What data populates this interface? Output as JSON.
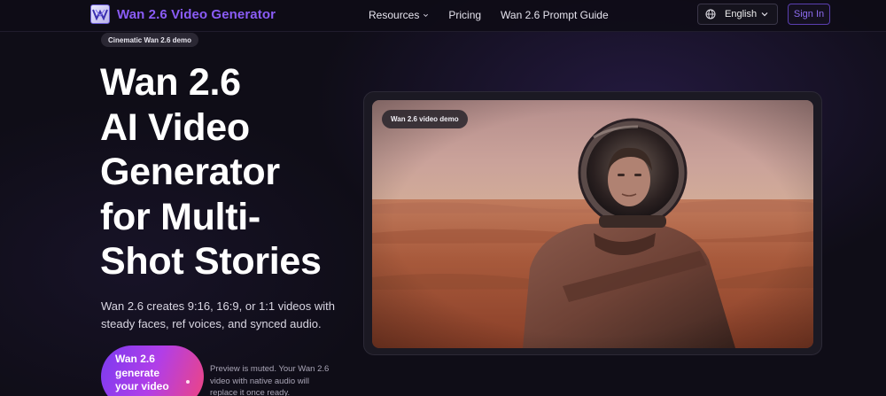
{
  "header": {
    "brand": "Wan 2.6 Video Generator",
    "nav": [
      {
        "label": "Resources"
      },
      {
        "label": "Pricing"
      },
      {
        "label": "Wan 2.6 Prompt Guide"
      }
    ],
    "language": "English",
    "sign_in": "Sign In"
  },
  "hero": {
    "badge": "Cinematic Wan 2.6 demo",
    "title_lines": [
      "Wan 2.6",
      "AI Video",
      "Generator",
      "for Multi-",
      "Shot Stories"
    ],
    "description": "Wan 2.6 creates 9:16, 16:9, or 1:1 videos with steady faces, ref voices, and synced audio.",
    "cta_lines": [
      "Wan 2.6",
      "generate",
      "your video"
    ],
    "preview_note": "Preview is muted. Your Wan 2.6 video with native audio will replace it once ready."
  },
  "video": {
    "badge": "Wan 2.6 video demo",
    "subject": "astronaut-on-desert"
  },
  "colors": {
    "background": "#0f0d17",
    "brand": "#8a5cf6",
    "cta_start": "#7b3bf0",
    "cta_end": "#f0457f"
  },
  "icons": [
    "logo-icon",
    "chevron-down-icon",
    "globe-icon"
  ]
}
